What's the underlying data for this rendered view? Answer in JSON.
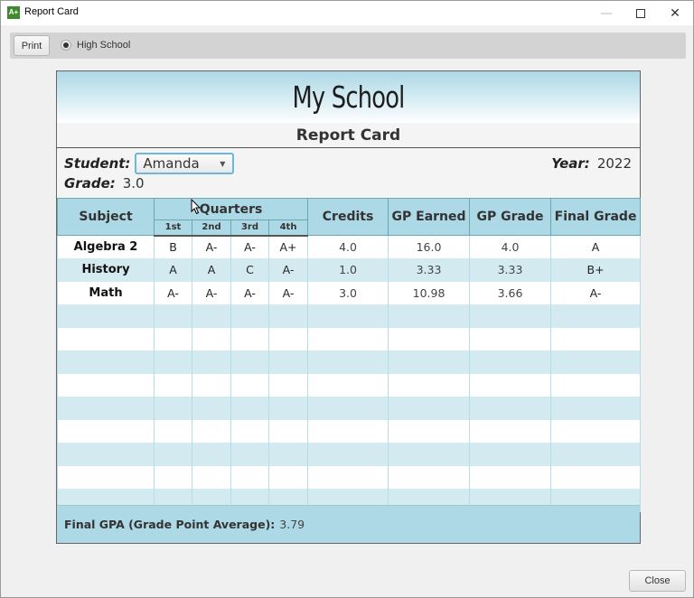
{
  "window": {
    "title": "Report Card",
    "app_icon_label": "A+",
    "app_icon_color": "#3f8a2e",
    "controls": {
      "minimize": "—",
      "close": "✕"
    }
  },
  "toolbar": {
    "print_label": "Print",
    "radio_label": "High School",
    "radio_selected": true
  },
  "card": {
    "school_name": "My School",
    "subtitle": "Report Card",
    "student_label": "Student:",
    "student_value": "Amanda",
    "grade_label": "Grade:",
    "grade_value": "3.0",
    "year_label": "Year:",
    "year_value": "2022",
    "header_color": "#add8e6",
    "stripe_color": "#d4eaf1"
  },
  "table": {
    "headers": {
      "subject": "Subject",
      "quarters": "Quarters",
      "q1": "1st",
      "q2": "2nd",
      "q3": "3rd",
      "q4": "4th",
      "credits": "Credits",
      "gp_earned": "GP Earned",
      "gp_grade": "GP Grade",
      "final_grade": "Final Grade"
    },
    "rows": [
      {
        "subject": "Algebra 2",
        "q1": "B",
        "q2": "A-",
        "q3": "A-",
        "q4": "A+",
        "credits": "4.0",
        "gp_earned": "16.0",
        "gp_grade": "4.0",
        "final_grade": "A"
      },
      {
        "subject": "History",
        "q1": "A",
        "q2": "A",
        "q3": "C",
        "q4": "A-",
        "credits": "1.0",
        "gp_earned": "3.33",
        "gp_grade": "3.33",
        "final_grade": "B+"
      },
      {
        "subject": "Math",
        "q1": "A-",
        "q2": "A-",
        "q3": "A-",
        "q4": "A-",
        "credits": "3.0",
        "gp_earned": "10.98",
        "gp_grade": "3.66",
        "final_grade": "A-"
      }
    ],
    "empty_rows": 9
  },
  "footer": {
    "gpa_label": "Final GPA (Grade Point Average):",
    "gpa_value": "3.79"
  },
  "close_label": "Close"
}
